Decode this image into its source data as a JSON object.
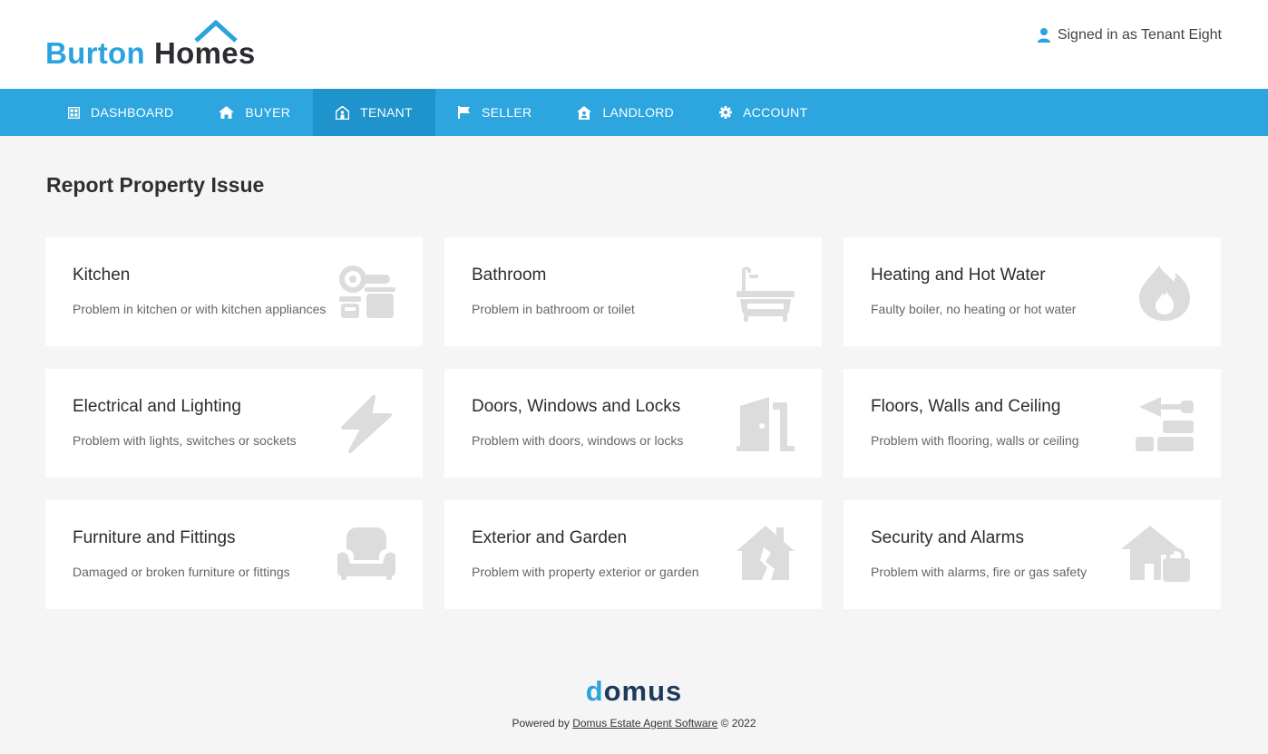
{
  "header": {
    "logo_word1": "Burton",
    "logo_word2": "Homes",
    "signed_in": "Signed in as Tenant Eight"
  },
  "nav": [
    {
      "label": "DASHBOARD",
      "icon": "dashboard-icon"
    },
    {
      "label": "BUYER",
      "icon": "home-icon"
    },
    {
      "label": "TENANT",
      "icon": "tenant-house-icon",
      "active": true
    },
    {
      "label": "SELLER",
      "icon": "flag-icon"
    },
    {
      "label": "LANDLORD",
      "icon": "landlord-house-icon"
    },
    {
      "label": "ACCOUNT",
      "icon": "gear-icon"
    }
  ],
  "main": {
    "title": "Report Property Issue",
    "cards": [
      {
        "title": "Kitchen",
        "desc": "Problem in kitchen or with kitchen appliances",
        "icon": "kitchen-appliance-icon"
      },
      {
        "title": "Bathroom",
        "desc": "Problem in bathroom or toilet",
        "icon": "bath-icon"
      },
      {
        "title": "Heating and Hot Water",
        "desc": "Faulty boiler, no heating or hot water",
        "icon": "flame-icon"
      },
      {
        "title": "Electrical and Lighting",
        "desc": "Problem with lights, switches or sockets",
        "icon": "lightning-icon"
      },
      {
        "title": "Doors, Windows and Locks",
        "desc": "Problem with doors, windows or locks",
        "icon": "door-icon"
      },
      {
        "title": "Floors, Walls and Ceiling",
        "desc": "Problem with flooring, walls or ceiling",
        "icon": "trowel-bricks-icon"
      },
      {
        "title": "Furniture and Fittings",
        "desc": "Damaged or broken furniture or fittings",
        "icon": "sofa-icon"
      },
      {
        "title": "Exterior and Garden",
        "desc": "Problem with property exterior or garden",
        "icon": "house-crack-icon"
      },
      {
        "title": "Security and Alarms",
        "desc": "Problem with alarms, fire or gas safety",
        "icon": "house-lock-icon"
      }
    ]
  },
  "footer": {
    "brand_first": "d",
    "brand_rest": "omus",
    "powered_prefix": "Powered by ",
    "powered_link": "Domus Estate Agent Software",
    "powered_suffix": " © 2022"
  },
  "colors": {
    "accent": "#2da6e0",
    "nav_active": "#1f93cc",
    "icon_grey": "#dcdcdc",
    "logo_dark": "#2b2d31"
  }
}
